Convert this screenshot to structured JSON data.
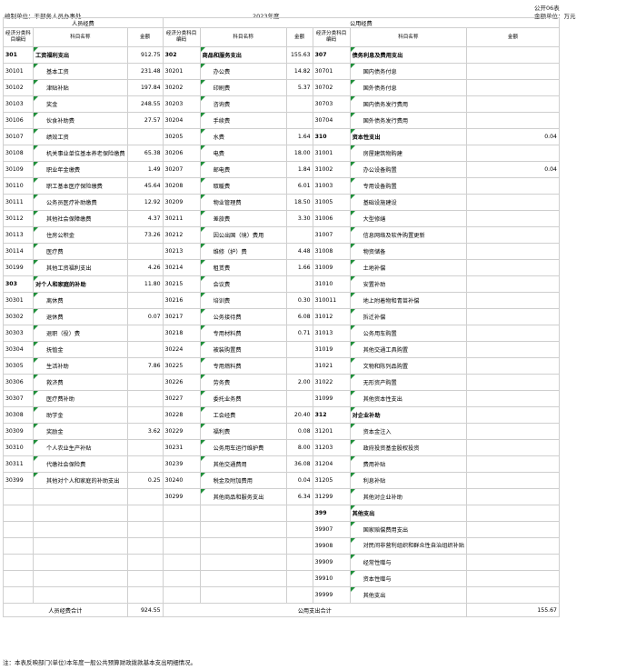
{
  "header": {
    "unit_label": "编制单位：干部务人员办事处",
    "year": "2023年度",
    "form_no": "公开06表",
    "money_unit": "金额单位：万元"
  },
  "sections": {
    "personnel": "人员经费",
    "public": "公用经费"
  },
  "columns": {
    "econ_code": "经济分类科目编码",
    "subject_name": "科目名称",
    "amount": "金额"
  },
  "rows": [
    {
      "a": {
        "code": "301",
        "name": "工资福利支出",
        "amount": "912.75",
        "bold": true
      },
      "b": {
        "code": "302",
        "name": "商品和服务支出",
        "amount": "155.63",
        "bold": true
      },
      "c": {
        "code": "307",
        "name": "债务利息及费用支出",
        "amount": "",
        "bold": true
      }
    },
    {
      "a": {
        "code": "30101",
        "name": "基本工资",
        "amount": "231.48"
      },
      "b": {
        "code": "30201",
        "name": "办公费",
        "amount": "14.82"
      },
      "c": {
        "code": "30701",
        "name": "国内债务付息",
        "amount": ""
      }
    },
    {
      "a": {
        "code": "30102",
        "name": "津贴补贴",
        "amount": "197.84"
      },
      "b": {
        "code": "30202",
        "name": "印刷费",
        "amount": "5.37"
      },
      "c": {
        "code": "30702",
        "name": "国外债务付息",
        "amount": ""
      }
    },
    {
      "a": {
        "code": "30103",
        "name": "奖金",
        "amount": "248.55"
      },
      "b": {
        "code": "30203",
        "name": "咨询费",
        "amount": ""
      },
      "c": {
        "code": "30703",
        "name": "国内债务发行费用",
        "amount": ""
      }
    },
    {
      "a": {
        "code": "30106",
        "name": "伙食补助费",
        "amount": "27.57"
      },
      "b": {
        "code": "30204",
        "name": "手续费",
        "amount": ""
      },
      "c": {
        "code": "30704",
        "name": "国外债务发行费用",
        "amount": ""
      }
    },
    {
      "a": {
        "code": "30107",
        "name": "绩效工资",
        "amount": ""
      },
      "b": {
        "code": "30205",
        "name": "水费",
        "amount": "1.64"
      },
      "c": {
        "code": "310",
        "name": "资本性支出",
        "amount": "0.04",
        "bold": true
      }
    },
    {
      "a": {
        "code": "30108",
        "name": "机关事业单位基本养老保险缴费",
        "amount": "65.38"
      },
      "b": {
        "code": "30206",
        "name": "电费",
        "amount": "18.00"
      },
      "c": {
        "code": "31001",
        "name": "房屋建筑物购建",
        "amount": ""
      }
    },
    {
      "a": {
        "code": "30109",
        "name": "职业年金缴费",
        "amount": "1.49"
      },
      "b": {
        "code": "30207",
        "name": "邮电费",
        "amount": "1.84"
      },
      "c": {
        "code": "31002",
        "name": "办公设备购置",
        "amount": "0.04"
      }
    },
    {
      "a": {
        "code": "30110",
        "name": "职工基本医疗保险缴费",
        "amount": "45.64"
      },
      "b": {
        "code": "30208",
        "name": "取暖费",
        "amount": "6.01"
      },
      "c": {
        "code": "31003",
        "name": "专用设备购置",
        "amount": ""
      }
    },
    {
      "a": {
        "code": "30111",
        "name": "公务员医疗补助缴费",
        "amount": "12.92"
      },
      "b": {
        "code": "30209",
        "name": "物业管理费",
        "amount": "18.50"
      },
      "c": {
        "code": "31005",
        "name": "基础设施建设",
        "amount": ""
      }
    },
    {
      "a": {
        "code": "30112",
        "name": "其他社会保障缴费",
        "amount": "4.37"
      },
      "b": {
        "code": "30211",
        "name": "差旅费",
        "amount": "3.30"
      },
      "c": {
        "code": "31006",
        "name": "大型修缮",
        "amount": ""
      }
    },
    {
      "a": {
        "code": "30113",
        "name": "住房公积金",
        "amount": "73.26"
      },
      "b": {
        "code": "30212",
        "name": "因公出国（境）费用",
        "amount": ""
      },
      "c": {
        "code": "31007",
        "name": "信息网络及软件购置更新",
        "amount": ""
      }
    },
    {
      "a": {
        "code": "30114",
        "name": "医疗费",
        "amount": ""
      },
      "b": {
        "code": "30213",
        "name": "维修（护）费",
        "amount": "4.48"
      },
      "c": {
        "code": "31008",
        "name": "物资储备",
        "amount": ""
      }
    },
    {
      "a": {
        "code": "30199",
        "name": "其他工资福利支出",
        "amount": "4.26"
      },
      "b": {
        "code": "30214",
        "name": "租赁费",
        "amount": "1.66"
      },
      "c": {
        "code": "31009",
        "name": "土地补偿",
        "amount": ""
      }
    },
    {
      "a": {
        "code": "303",
        "name": "对个人和家庭的补助",
        "amount": "11.80",
        "bold": true
      },
      "b": {
        "code": "30215",
        "name": "会议费",
        "amount": ""
      },
      "c": {
        "code": "31010",
        "name": "安置补助",
        "amount": ""
      }
    },
    {
      "a": {
        "code": "30301",
        "name": "离休费",
        "amount": ""
      },
      "b": {
        "code": "30216",
        "name": "培训费",
        "amount": "0.30"
      },
      "c": {
        "code": "310011",
        "name": "地上附着物和青苗补偿",
        "amount": ""
      }
    },
    {
      "a": {
        "code": "30302",
        "name": "退休费",
        "amount": "0.07"
      },
      "b": {
        "code": "30217",
        "name": "公务接待费",
        "amount": "6.08"
      },
      "c": {
        "code": "31012",
        "name": "拆迁补偿",
        "amount": ""
      }
    },
    {
      "a": {
        "code": "30303",
        "name": "退职（役）费",
        "amount": ""
      },
      "b": {
        "code": "30218",
        "name": "专用材料费",
        "amount": "0.71"
      },
      "c": {
        "code": "31013",
        "name": "公务用车购置",
        "amount": ""
      }
    },
    {
      "a": {
        "code": "30304",
        "name": "抚恤金",
        "amount": ""
      },
      "b": {
        "code": "30224",
        "name": "被装购置费",
        "amount": ""
      },
      "c": {
        "code": "31019",
        "name": "其他交通工具购置",
        "amount": ""
      }
    },
    {
      "a": {
        "code": "30305",
        "name": "生活补助",
        "amount": "7.86"
      },
      "b": {
        "code": "30225",
        "name": "专用燃料费",
        "amount": ""
      },
      "c": {
        "code": "31021",
        "name": "文物和陈列品购置",
        "amount": ""
      }
    },
    {
      "a": {
        "code": "30306",
        "name": "救济费",
        "amount": ""
      },
      "b": {
        "code": "30226",
        "name": "劳务费",
        "amount": "2.00"
      },
      "c": {
        "code": "31022",
        "name": "无形资产购置",
        "amount": ""
      }
    },
    {
      "a": {
        "code": "30307",
        "name": "医疗费补助",
        "amount": ""
      },
      "b": {
        "code": "30227",
        "name": "委托业务费",
        "amount": ""
      },
      "c": {
        "code": "31099",
        "name": "其他资本性支出",
        "amount": ""
      }
    },
    {
      "a": {
        "code": "30308",
        "name": "助学金",
        "amount": ""
      },
      "b": {
        "code": "30228",
        "name": "工会经费",
        "amount": "20.40"
      },
      "c": {
        "code": "312",
        "name": "对企业补助",
        "amount": "",
        "bold": true
      }
    },
    {
      "a": {
        "code": "30309",
        "name": "奖励金",
        "amount": "3.62"
      },
      "b": {
        "code": "30229",
        "name": "福利费",
        "amount": "0.08"
      },
      "c": {
        "code": "31201",
        "name": "资本金注入",
        "amount": ""
      }
    },
    {
      "a": {
        "code": "30310",
        "name": "个人农业生产补贴",
        "amount": ""
      },
      "b": {
        "code": "30231",
        "name": "公务用车运行维护费",
        "amount": "8.00"
      },
      "c": {
        "code": "31203",
        "name": "政府投资基金股权投资",
        "amount": ""
      }
    },
    {
      "a": {
        "code": "30311",
        "name": "代缴社会保险费",
        "amount": ""
      },
      "b": {
        "code": "30239",
        "name": "其他交通费用",
        "amount": "36.08"
      },
      "c": {
        "code": "31204",
        "name": "费用补贴",
        "amount": ""
      }
    },
    {
      "a": {
        "code": "30399",
        "name": "其他对个人和家庭的补助支出",
        "amount": "0.25"
      },
      "b": {
        "code": "30240",
        "name": "税金及附加费用",
        "amount": "0.04"
      },
      "c": {
        "code": "31205",
        "name": "利息补贴",
        "amount": ""
      }
    },
    {
      "a": {
        "code": "",
        "name": "",
        "amount": ""
      },
      "b": {
        "code": "30299",
        "name": "其他商品和服务支出",
        "amount": "6.34"
      },
      "c": {
        "code": "31299",
        "name": "其他对企业补助",
        "amount": ""
      }
    },
    {
      "a": {
        "code": "",
        "name": "",
        "amount": ""
      },
      "b": {
        "code": "",
        "name": "",
        "amount": ""
      },
      "c": {
        "code": "399",
        "name": "其他支出",
        "amount": "",
        "bold": true
      }
    },
    {
      "a": {
        "code": "",
        "name": "",
        "amount": ""
      },
      "b": {
        "code": "",
        "name": "",
        "amount": ""
      },
      "c": {
        "code": "39907",
        "name": "国家赔偿费用支出",
        "amount": ""
      }
    },
    {
      "a": {
        "code": "",
        "name": "",
        "amount": ""
      },
      "b": {
        "code": "",
        "name": "",
        "amount": ""
      },
      "c": {
        "code": "39908",
        "name": "对民间非营利组织和群众性自治组织补贴",
        "amount": "",
        "wrap": true
      }
    },
    {
      "a": {
        "code": "",
        "name": "",
        "amount": ""
      },
      "b": {
        "code": "",
        "name": "",
        "amount": ""
      },
      "c": {
        "code": "39909",
        "name": "经常性赠与",
        "amount": ""
      }
    },
    {
      "a": {
        "code": "",
        "name": "",
        "amount": ""
      },
      "b": {
        "code": "",
        "name": "",
        "amount": ""
      },
      "c": {
        "code": "39910",
        "name": "资本性赠与",
        "amount": ""
      }
    },
    {
      "a": {
        "code": "",
        "name": "",
        "amount": ""
      },
      "b": {
        "code": "",
        "name": "",
        "amount": ""
      },
      "c": {
        "code": "39999",
        "name": "其他支出",
        "amount": ""
      }
    }
  ],
  "totals": {
    "personnel_label": "人员经费合计",
    "personnel_amount": "924.55",
    "public_label": "公用支出合计",
    "public_amount": "155.67"
  },
  "note": "注：本表反映部门(单位)本年度一般公共预算财政拨款基本支出明细情况。"
}
